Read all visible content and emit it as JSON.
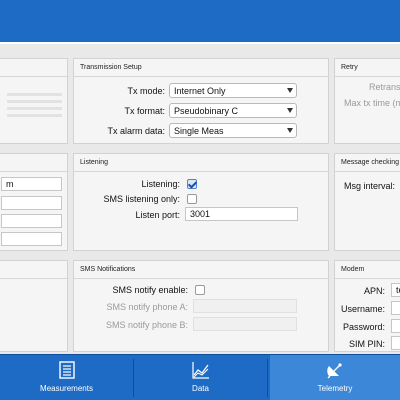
{
  "colors": {
    "accent": "#1e6bc5",
    "active_tab": "#3c87d8",
    "panel": "#f5f5f5"
  },
  "transmission": {
    "title": "Transmission Setup",
    "tx_mode_label": "Tx mode:",
    "tx_mode_value": "Internet Only",
    "tx_format_label": "Tx format:",
    "tx_format_value": "Pseudobinary C",
    "tx_alarm_label": "Tx alarm data:",
    "tx_alarm_value": "Single Meas"
  },
  "retry": {
    "title": "Retry",
    "retransmit_label": "Retransm",
    "max_tx_label": "Max tx time (m"
  },
  "left_middle": {
    "field1_value": "m"
  },
  "listening": {
    "title": "Listening",
    "listening_label": "Listening:",
    "listening_checked": true,
    "sms_only_label": "SMS listening only:",
    "sms_only_checked": false,
    "port_label": "Listen port:",
    "port_value": "3001"
  },
  "message_checking": {
    "title": "Message checking",
    "interval_label": "Msg interval:"
  },
  "sms_notifications": {
    "title": "SMS Notifications",
    "enable_label": "SMS notify enable:",
    "enable_checked": false,
    "phone_a_label": "SMS notify phone A:",
    "phone_b_label": "SMS notify phone B:"
  },
  "modem": {
    "title": "Modem",
    "apn_label": "APN:",
    "apn_value": "te",
    "username_label": "Username:",
    "password_label": "Password:",
    "sim_pin_label": "SIM PIN:"
  },
  "nav": {
    "measurements_label": "Measurements",
    "data_label": "Data",
    "telemetry_label": "Telemetry",
    "active_tab": "Telemetry"
  }
}
